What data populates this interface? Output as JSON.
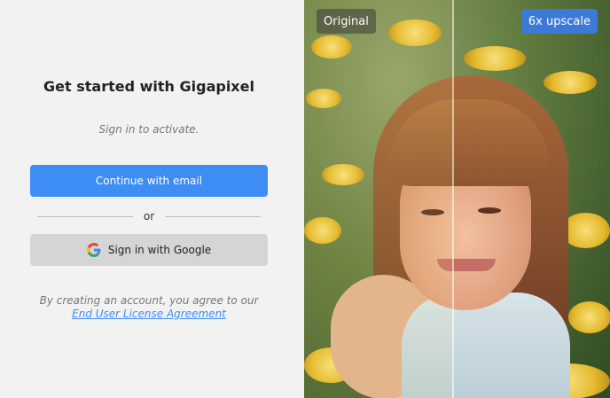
{
  "signin": {
    "title": "Get started with Gigapixel",
    "subtitle": "Sign in to activate.",
    "email_button": "Continue with email",
    "divider": "or",
    "google_button": "Sign in with Google",
    "legal_text": "By creating an account, you agree to our",
    "legal_link": "End User License Agreement"
  },
  "preview": {
    "left_label": "Original",
    "right_label": "6x upscale"
  },
  "colors": {
    "accent": "#3d8df5",
    "left_bg": "#f2f2f2",
    "google_button_bg": "#d5d5d5"
  }
}
